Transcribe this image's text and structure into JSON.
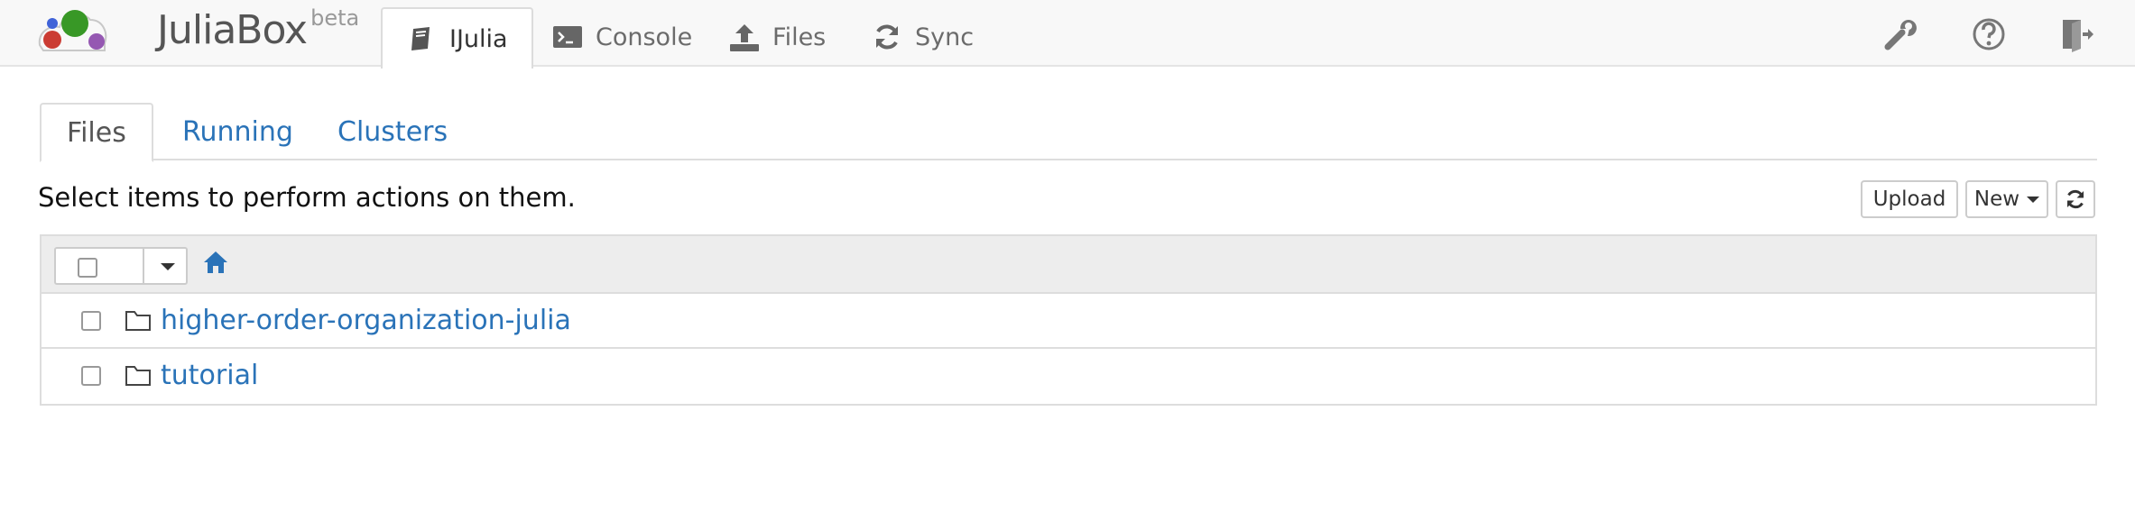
{
  "app": {
    "brand_name": "JuliaBox",
    "brand_badge": "beta",
    "logo_colors": [
      "#389826",
      "#cb3c33",
      "#9558b2",
      "#4063d8"
    ]
  },
  "nav": {
    "tabs": [
      {
        "label": "IJulia",
        "icon": "notebook-icon",
        "active": true
      },
      {
        "label": "Console",
        "icon": "terminal-icon",
        "active": false
      },
      {
        "label": "Files",
        "icon": "upload-icon",
        "active": false
      },
      {
        "label": "Sync",
        "icon": "sync-icon",
        "active": false
      }
    ],
    "tools": [
      "wrench-icon",
      "help-icon",
      "logout-icon"
    ]
  },
  "subtabs": [
    {
      "label": "Files",
      "active": true
    },
    {
      "label": "Running",
      "active": false
    },
    {
      "label": "Clusters",
      "active": false
    }
  ],
  "toolbar": {
    "hint": "Select items to perform actions on them.",
    "upload_label": "Upload",
    "new_label": "New",
    "refresh_icon": "refresh-icon"
  },
  "file_list": {
    "home_icon": "home-icon",
    "items": [
      {
        "name": "higher-order-organization-julia",
        "type": "folder"
      },
      {
        "name": "tutorial",
        "type": "folder"
      }
    ]
  },
  "colors": {
    "link": "#2a73b8",
    "navbar_bg": "#f8f8f8",
    "header_bg": "#ededed"
  }
}
